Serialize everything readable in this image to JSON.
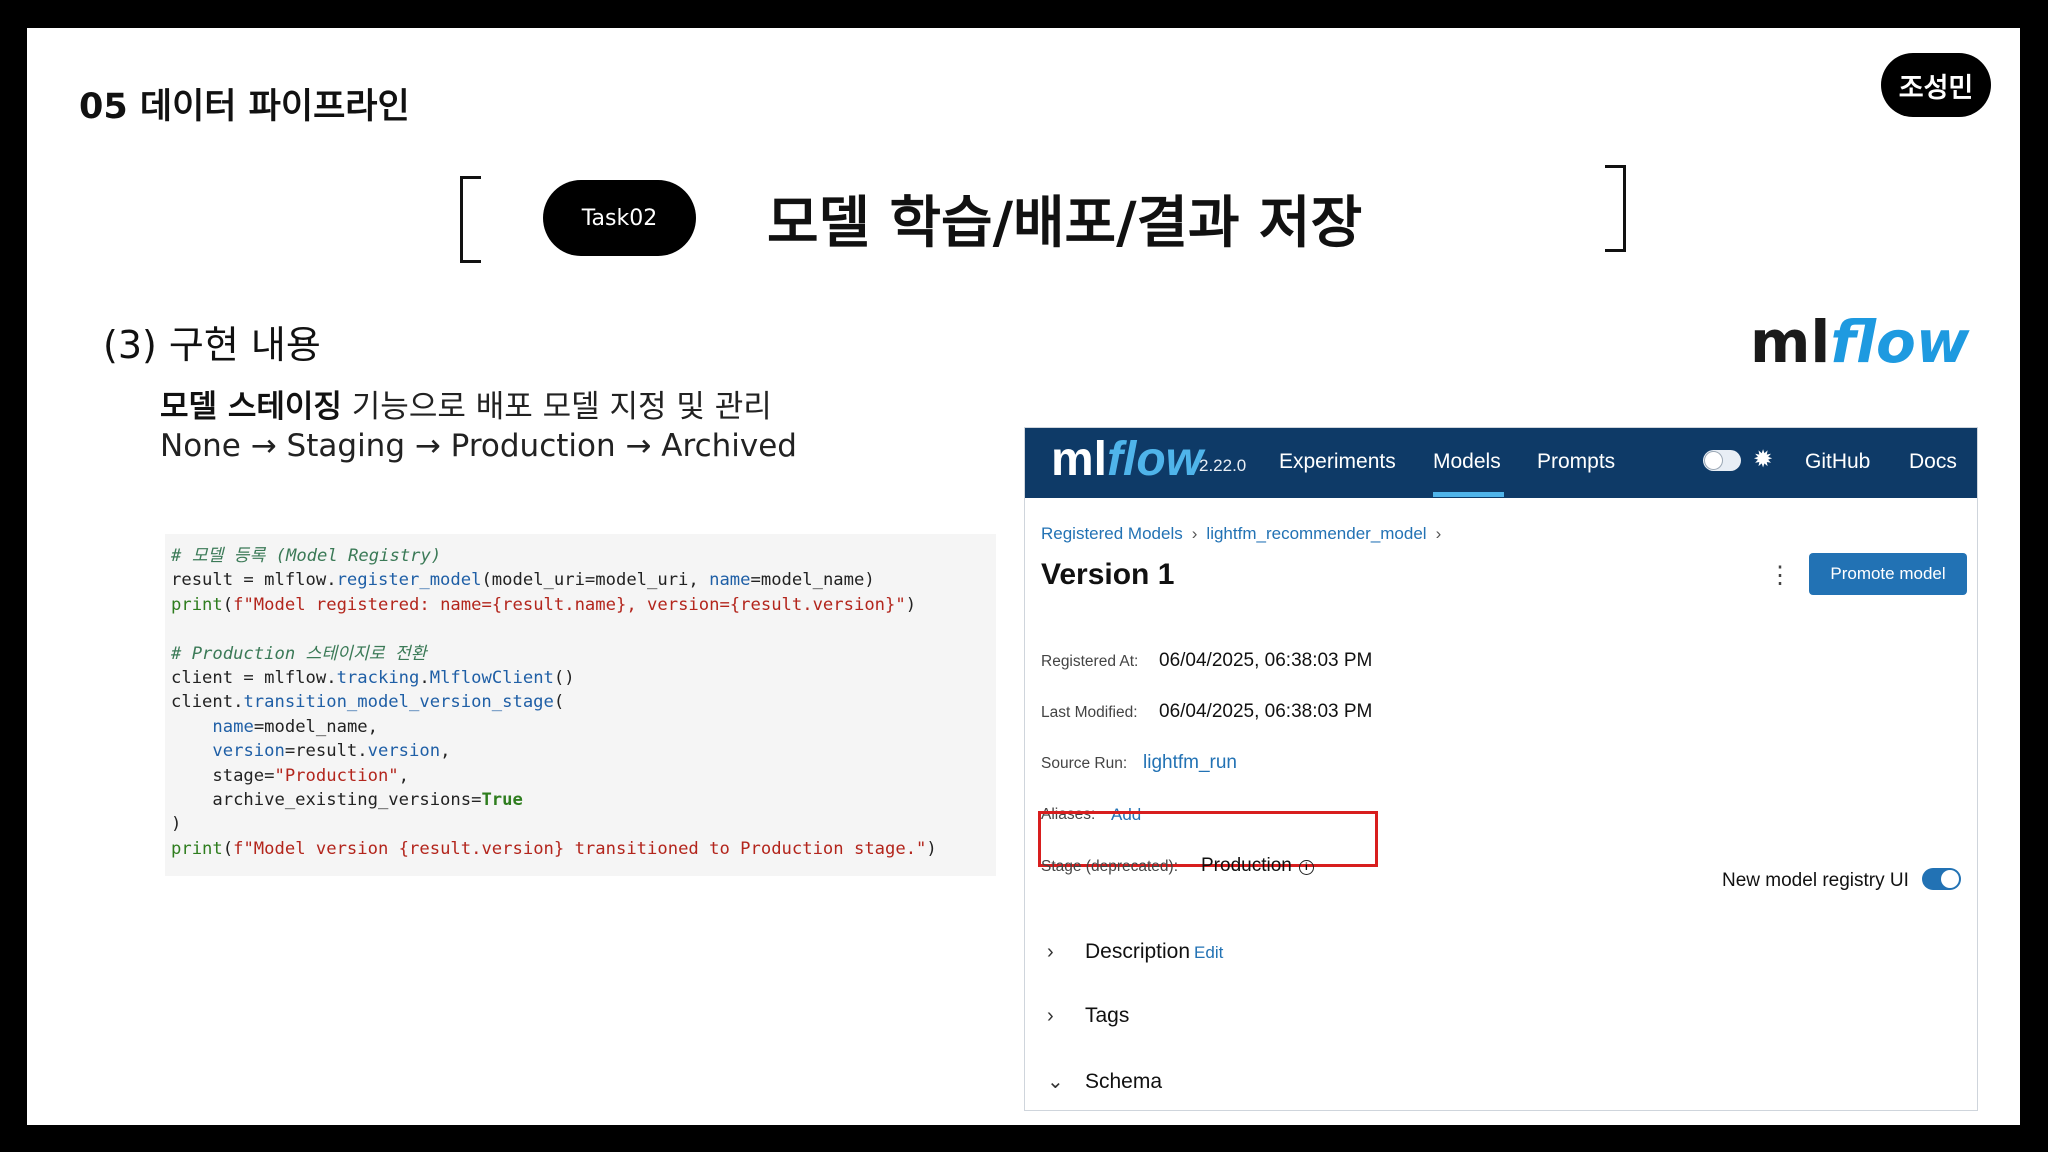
{
  "slide": {
    "section_title": "05 데이터 파이프라인",
    "author": "조성민",
    "task_label": "Task02",
    "main_title": "모델 학습/배포/결과 저장",
    "impl_heading": "(3) 구현 내용",
    "impl_bold": "모델 스테이징",
    "impl_rest": " 기능으로 배포 모델 지정 및 관리",
    "impl_flow": "None → Staging → Production → Archived",
    "brand_ml": "ml",
    "brand_flow": "flow"
  },
  "code": {
    "lines": [
      "# 모델 등록 (Model Registry)",
      "result = mlflow.register_model(model_uri=model_uri, name=model_name)",
      "print(f\"Model registered: name={result.name}, version={result.version}\")",
      "",
      "# Production 스테이지로 전환",
      "client = mlflow.tracking.MlflowClient()",
      "client.transition_model_version_stage(",
      "    name=model_name,",
      "    version=result.version,",
      "    stage=\"Production\",",
      "    archive_existing_versions=True",
      ")",
      "print(f\"Model version {result.version} transitioned to Production stage.\")"
    ]
  },
  "mlflow": {
    "logo_ml": "ml",
    "logo_flow": "flow",
    "version": "2.22.0",
    "nav": {
      "experiments": "Experiments",
      "models": "Models",
      "prompts": "Prompts",
      "github": "GitHub",
      "docs": "Docs"
    },
    "breadcrumb": {
      "registered_models": "Registered Models",
      "model_name": "lightfm_recommender_model",
      "sep": "›"
    },
    "version_title": "Version 1",
    "promote_button": "Promote model",
    "registered_at_label": "Registered At:",
    "registered_at_value": "06/04/2025, 06:38:03 PM",
    "last_modified_label": "Last Modified:",
    "last_modified_value": "06/04/2025, 06:38:03 PM",
    "source_run_label": "Source Run:",
    "source_run_value": "lightfm_run",
    "aliases_label": "Aliases:",
    "aliases_add": "Add",
    "stage_label": "Stage (deprecated):",
    "stage_value": "Production",
    "new_registry_label": "New model registry UI",
    "sections": {
      "description": "Description",
      "description_edit": "Edit",
      "tags": "Tags",
      "schema": "Schema"
    },
    "colors": {
      "navbar": "#0e3a67",
      "primary": "#2272b4",
      "highlight": "#d81e1e"
    }
  }
}
